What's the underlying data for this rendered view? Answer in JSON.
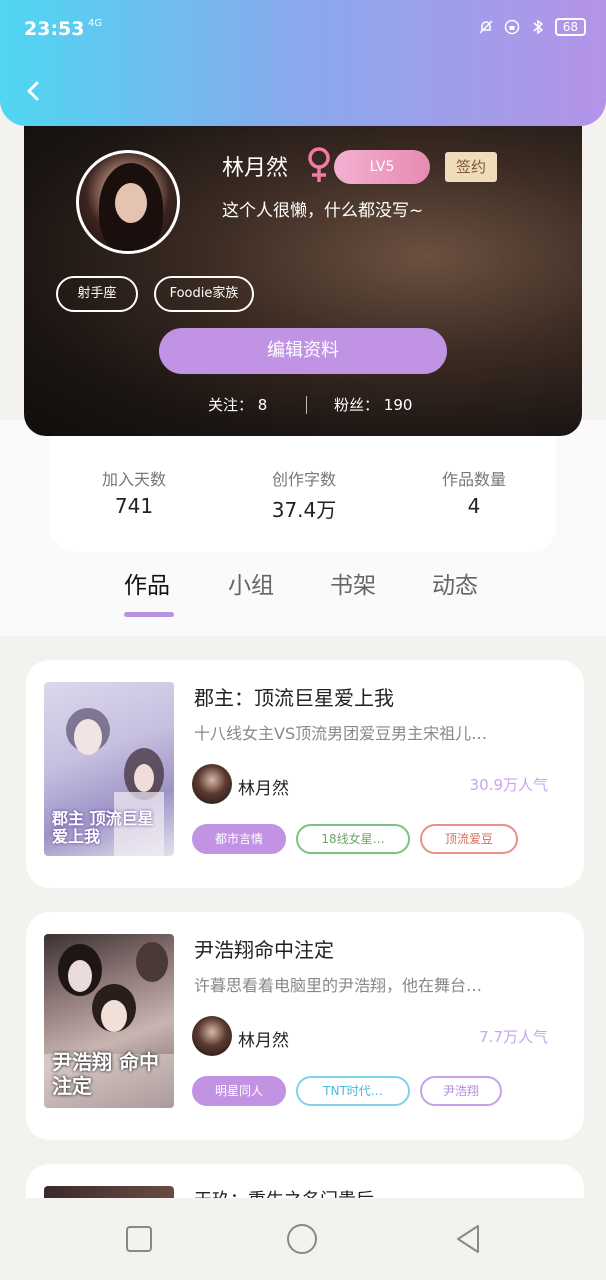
{
  "status_bar": {
    "time": "23:53",
    "network": "4G",
    "battery": "68"
  },
  "profile": {
    "name": "林月然",
    "gender_symbol": "♀",
    "level": "LV5",
    "signed_badge": "签约",
    "bio": "这个人很懒，什么都没写~",
    "tags": [
      "射手座",
      "Foodie家族"
    ],
    "edit_button": "编辑资料",
    "following_label": "关注",
    "following_count": "8",
    "followers_label": "粉丝",
    "followers_count": "190"
  },
  "stats": [
    {
      "label": "加入天数",
      "value": "741"
    },
    {
      "label": "创作字数",
      "value": "37.4万"
    },
    {
      "label": "作品数量",
      "value": "4"
    }
  ],
  "tabs": [
    "作品",
    "小组",
    "书架",
    "动态"
  ],
  "active_tab": "作品",
  "works": [
    {
      "title": "郡主：顶流巨星爱上我",
      "desc": "十八线女主VS顶流男团爱豆男主宋祖儿…",
      "author": "林月然",
      "popularity": "30.9万人气",
      "cover_text": "郡主 顶流巨星 爱上我",
      "tags": [
        "都市言情",
        "18线女星…",
        "顶流爱豆"
      ]
    },
    {
      "title": "尹浩翔命中注定",
      "desc": "许暮思看着电脑里的尹浩翔，他在舞台…",
      "author": "林月然",
      "popularity": "7.7万人气",
      "cover_text": "尹浩翔 命中 注定",
      "tags": [
        "明星同人",
        "TNT时代…",
        "尹浩翔"
      ]
    },
    {
      "title": "天玖：重生之名门贵后"
    }
  ],
  "colors": {
    "accent": "#c193e4",
    "top_gradient_start": "#4fd6f2",
    "top_gradient_end": "#b493e8"
  }
}
